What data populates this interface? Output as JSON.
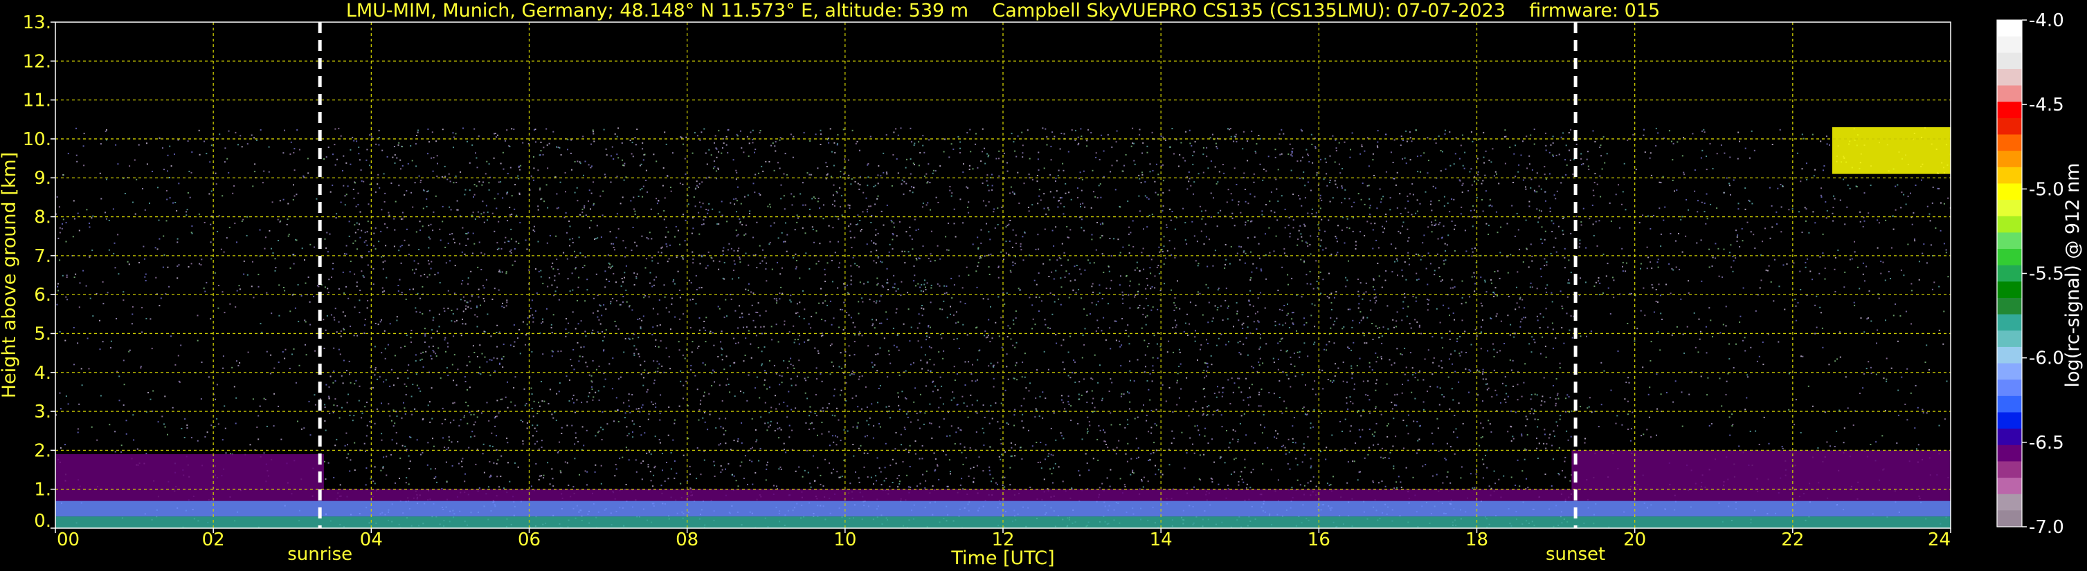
{
  "chart_data": {
    "type": "heatmap",
    "title": "LMU-MIM, Munich, Germany; 48.148° N 11.573° E, altitude: 539 m    Campbell SkyVUEPRO CS135 (CS135LMU): 07-07-2023    firmware: 015",
    "xlabel": "Time [UTC]",
    "ylabel": "Height above ground [km]",
    "xlim": [
      0,
      24
    ],
    "ylim": [
      0,
      13
    ],
    "x_ticks": [
      0,
      2,
      4,
      6,
      8,
      10,
      12,
      14,
      16,
      18,
      20,
      22,
      24
    ],
    "x_tick_labels": [
      "00",
      "02",
      "04",
      "06",
      "08",
      "10",
      "12",
      "14",
      "16",
      "18",
      "20",
      "22",
      "24"
    ],
    "y_ticks": [
      0,
      1,
      2,
      3,
      4,
      5,
      6,
      7,
      8,
      9,
      10,
      11,
      12,
      13
    ],
    "y_tick_labels": [
      "0.",
      "1.",
      "2.",
      "3.",
      "4.",
      "5.",
      "6.",
      "7.",
      "8.",
      "9.",
      "10.",
      "11.",
      "12.",
      "13."
    ],
    "grid": true,
    "data_top_km": 10.3,
    "event_lines": [
      {
        "label": "sunrise",
        "x": 3.35
      },
      {
        "label": "sunset",
        "x": 19.25
      }
    ],
    "layers": [
      {
        "x_start": 0,
        "x_end": 24,
        "y_bottom": 0,
        "y_top": 0.3,
        "level": -5.8
      },
      {
        "x_start": 0,
        "x_end": 24,
        "y_bottom": 0.3,
        "y_top": 0.7,
        "level": -6.2
      },
      {
        "x_start": 0,
        "x_end": 3.4,
        "y_bottom": 0.7,
        "y_top": 1.9,
        "level": -6.55
      },
      {
        "x_start": 3.4,
        "x_end": 19.2,
        "y_bottom": 0.7,
        "y_top": 1.0,
        "level": -6.55
      },
      {
        "x_start": 19.2,
        "x_end": 24,
        "y_bottom": 0.7,
        "y_top": 2.0,
        "level": -6.55
      },
      {
        "x_start": 22.5,
        "x_end": 24,
        "y_bottom": 9.1,
        "y_top": 10.3,
        "level": -5.0
      }
    ],
    "colorbar": {
      "label": "log(rc-signal) @ 912 nm",
      "min": -7.0,
      "max": -4.0,
      "ticks": [
        -4.0,
        -4.5,
        -5.0,
        -5.5,
        -6.0,
        -6.5,
        -7.0
      ],
      "tick_labels": [
        "-4.0",
        "-4.5",
        "-5.0",
        "-5.5",
        "-6.0",
        "-6.5",
        "-7.0"
      ],
      "colors": [
        "#ffffff",
        "#f4f4f4",
        "#e8e8e8",
        "#e8c8c8",
        "#f09090",
        "#ff0000",
        "#ee2200",
        "#ff6600",
        "#ff9900",
        "#ffcc00",
        "#ffff00",
        "#e6ff33",
        "#a8f020",
        "#66e066",
        "#33cc33",
        "#22aa55",
        "#008800",
        "#228833",
        "#33aa99",
        "#66c0c0",
        "#99ccee",
        "#88aaff",
        "#6688ff",
        "#3366ff",
        "#0022ee",
        "#3300aa",
        "#660077",
        "#993388",
        "#bb66aa",
        "#aa99aa",
        "#998899"
      ]
    },
    "colors": {
      "text": "#ffff33",
      "grid": "#cccc00",
      "background": "#000000",
      "event_line": "#ffffff"
    }
  }
}
